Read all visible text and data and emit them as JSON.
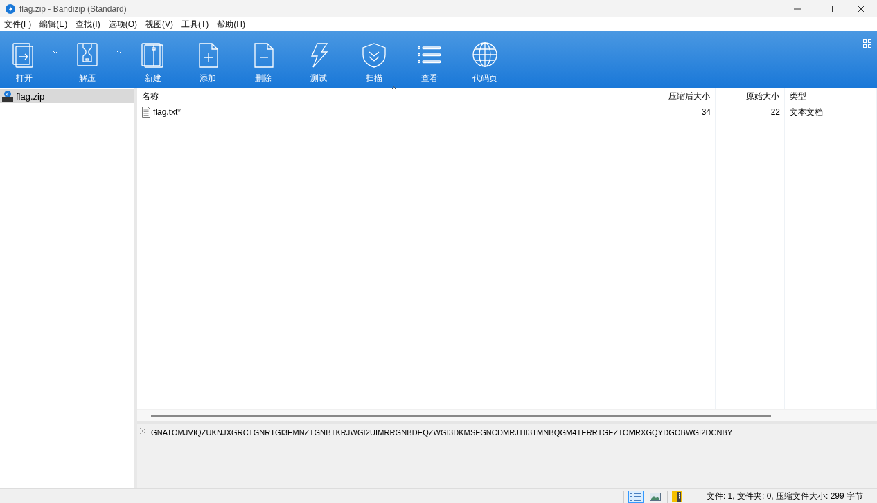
{
  "window": {
    "title": "flag.zip - Bandizip (Standard)"
  },
  "menu": [
    "文件(F)",
    "编辑(E)",
    "查找(I)",
    "选项(O)",
    "视图(V)",
    "工具(T)",
    "帮助(H)"
  ],
  "toolbar": [
    {
      "kind": "open",
      "label": "打开",
      "has_menu": true
    },
    {
      "kind": "extract",
      "label": "解压",
      "has_menu": true
    },
    {
      "kind": "new",
      "label": "新建",
      "has_menu": false
    },
    {
      "kind": "add",
      "label": "添加",
      "has_menu": false
    },
    {
      "kind": "delete",
      "label": "删除",
      "has_menu": false
    },
    {
      "kind": "test",
      "label": "测试",
      "has_menu": false
    },
    {
      "kind": "scan",
      "label": "扫描",
      "has_menu": false
    },
    {
      "kind": "view",
      "label": "查看",
      "has_menu": false
    },
    {
      "kind": "codepage",
      "label": "代码页",
      "has_menu": false
    }
  ],
  "sidebar": {
    "items": [
      {
        "label": "flag.zip",
        "selected": true
      }
    ]
  },
  "table": {
    "columns": [
      {
        "label": "名称",
        "sorted": true
      },
      {
        "label": "压缩后大小",
        "sorted": false
      },
      {
        "label": "原始大小",
        "sorted": false
      },
      {
        "label": "类型",
        "sorted": false
      }
    ],
    "rows": [
      {
        "cells": [
          "flag.txt*",
          "34",
          "22",
          "文本文档"
        ],
        "selected": false
      }
    ]
  },
  "comment": {
    "text": "GNATOMJVIQZUKNJXGRCTGNRTGI3EMNZTGNBTKRJWGI2UIMRRGNBDEQZWGI3DKMSFGNCDMRJTII3TMNBQGM4TERRTGEZTOMRXGQYDGOBWGI2DCNBY"
  },
  "status_bar": {
    "view_modes": [
      {
        "kind": "details",
        "selected": true
      },
      {
        "kind": "preview",
        "selected": false
      }
    ],
    "text": "文件: 1, 文件夹: 0, 压缩文件大小: 299 字节"
  }
}
